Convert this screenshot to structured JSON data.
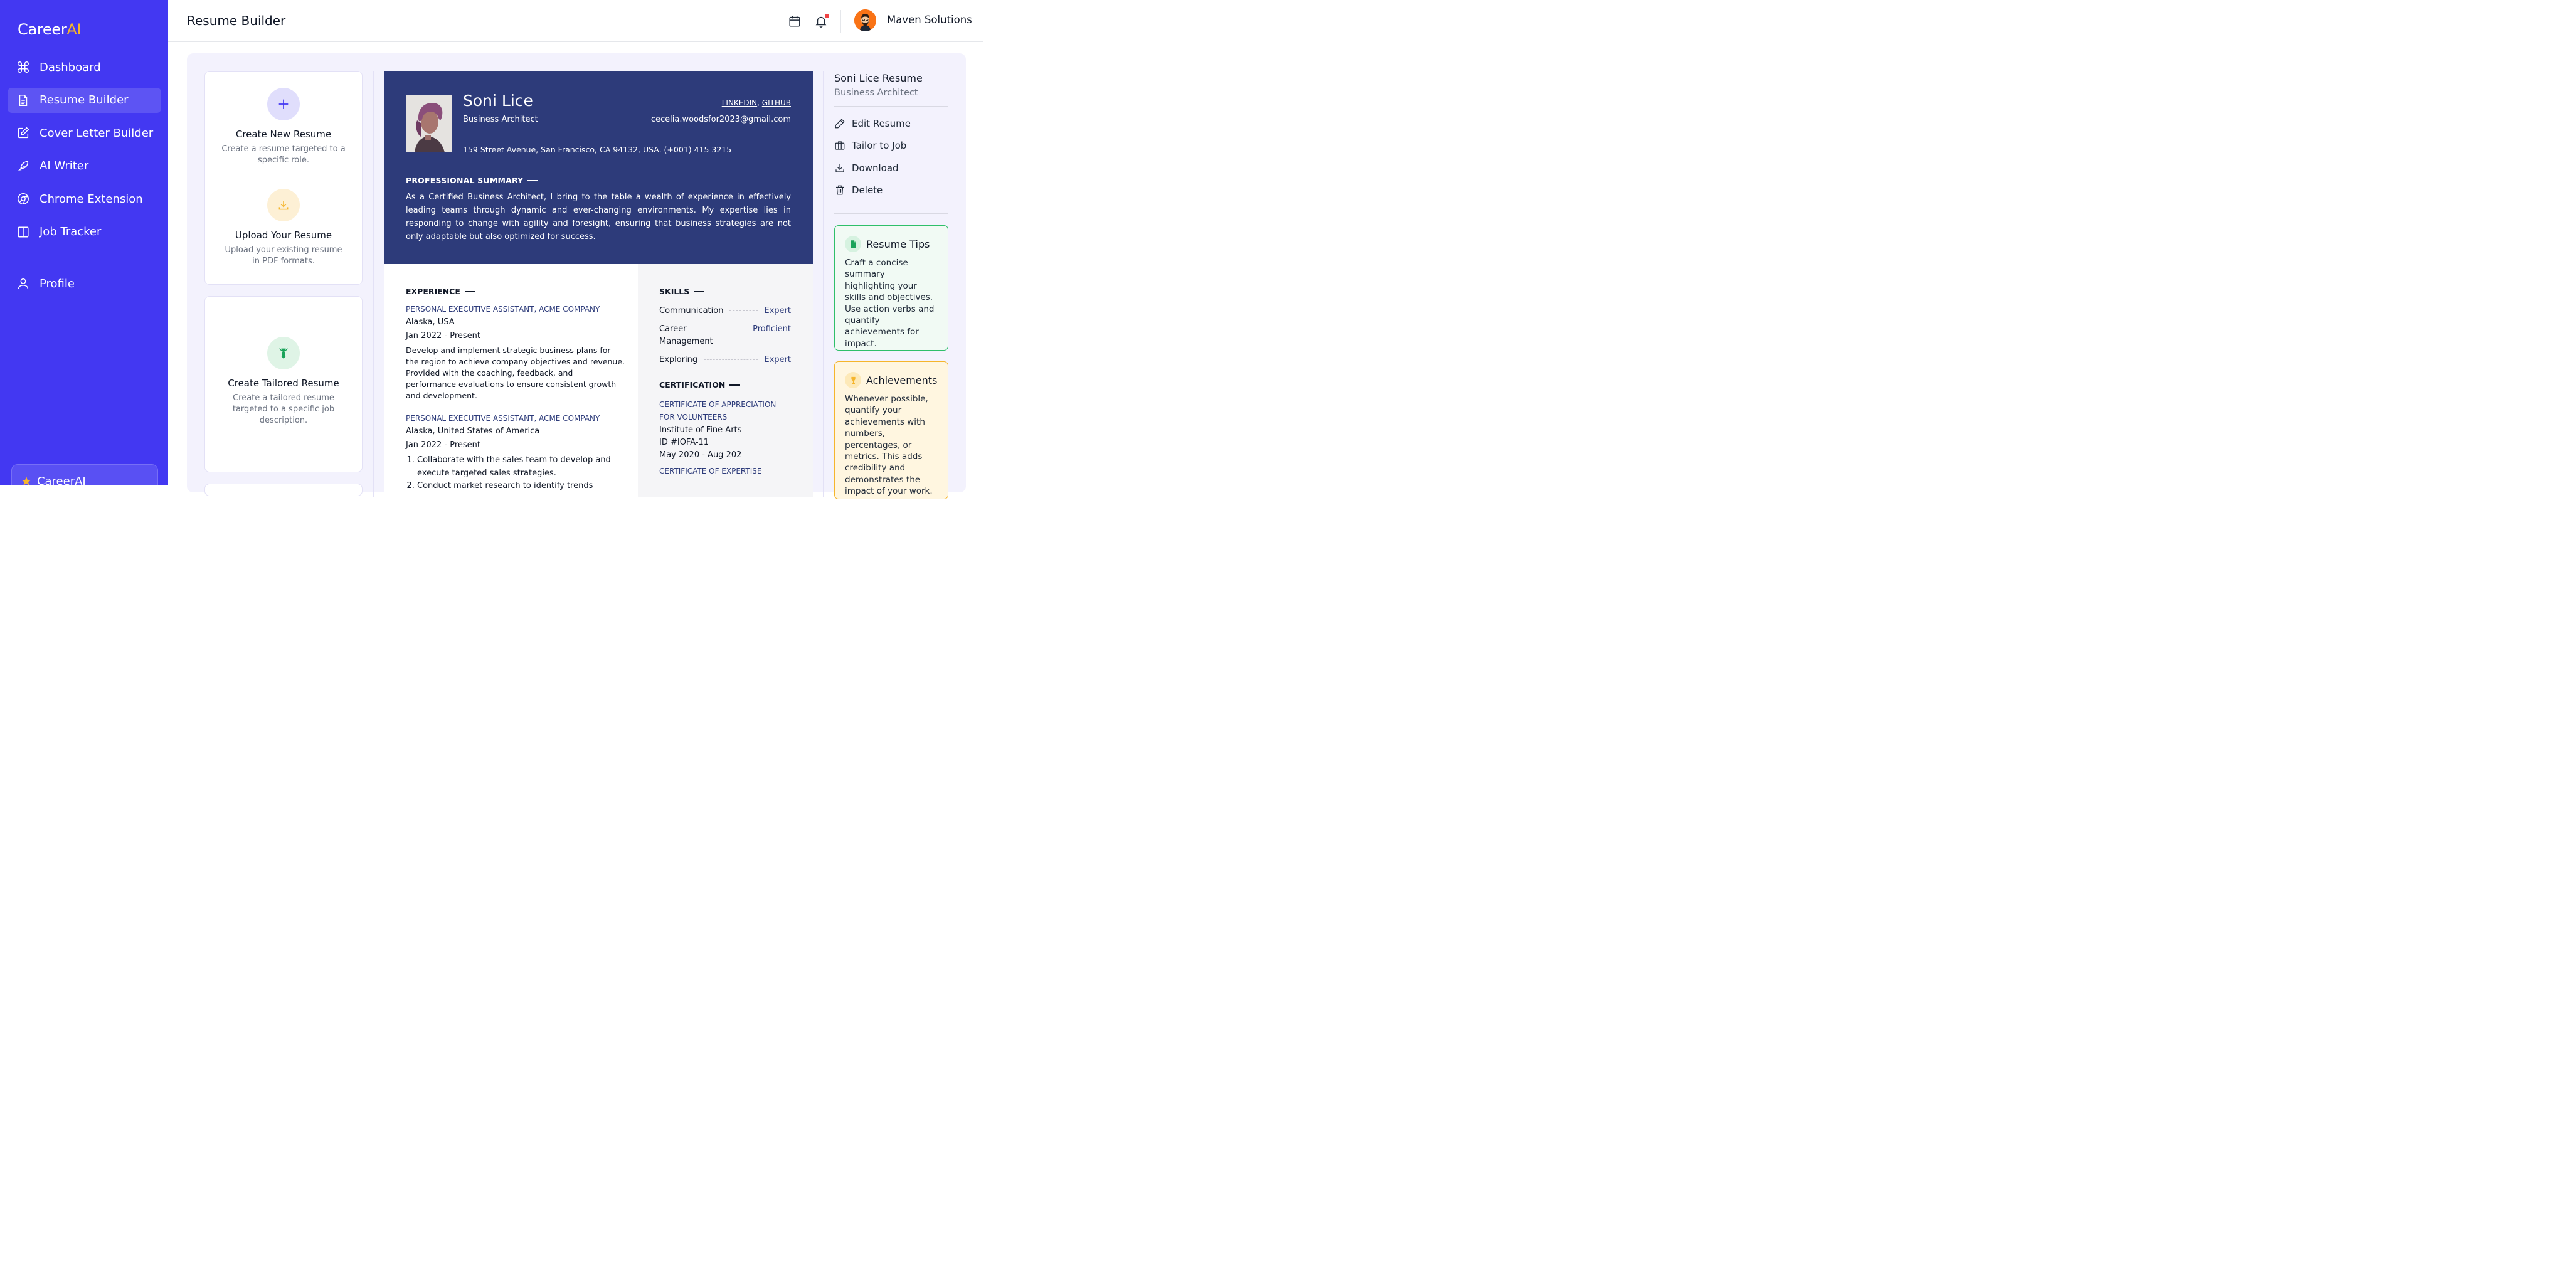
{
  "brand": {
    "name_main": "Career",
    "name_accent": "AI"
  },
  "sidebar": {
    "items": [
      {
        "label": "Dashboard",
        "icon": "command-icon"
      },
      {
        "label": "Resume Builder",
        "icon": "document-icon",
        "active": true
      },
      {
        "label": "Cover Letter Builder",
        "icon": "edit-icon"
      },
      {
        "label": "AI Writer",
        "icon": "feather-icon"
      },
      {
        "label": "Chrome Extension",
        "icon": "chrome-icon"
      },
      {
        "label": "Job Tracker",
        "icon": "columns-icon"
      }
    ],
    "profile_label": "Profile",
    "promo_label": "CareerAI"
  },
  "header": {
    "title": "Resume Builder",
    "org_name": "Maven Solutions"
  },
  "options": {
    "create_new": {
      "title": "Create New Resume",
      "desc": "Create a resume targeted to a specific role."
    },
    "upload": {
      "title": "Upload Your Resume",
      "desc": "Upload your existing resume in PDF formats."
    },
    "tailored": {
      "title": "Create Tailored Resume",
      "desc": "Create a tailored resume targeted to a specific job description."
    }
  },
  "resume": {
    "name": "Soni Lice",
    "role": "Business Architect",
    "link_linkedin": "LINKEDIN",
    "link_sep": ", ",
    "link_github": "GITHUB",
    "email": "cecelia.woodsfor2023@gmail.com",
    "address": "159 Street Avenue, San Francisco, CA 94132, USA. (+001) 415 3215",
    "summary_heading": "PROFESSIONAL SUMMARY",
    "summary": "As a Certified Business Architect, I bring to the table a wealth of experience in effectively leading teams through dynamic and ever-changing environments. My expertise lies in responding to change with agility and foresight, ensuring that business strategies are not only adaptable but also optimized for success.",
    "experience_heading": "EXPERIENCE",
    "jobs": [
      {
        "title": "PERSONAL EXECUTIVE ASSISTANT, ACME COMPANY",
        "location": "Alaska, USA",
        "dates": "Jan 2022 - Present",
        "desc": "Develop and implement strategic business plans for the region to achieve company objectives and revenue. Provided with the coaching, feedback, and performance evaluations to ensure consistent growth and development."
      },
      {
        "title": "PERSONAL EXECUTIVE ASSISTANT, ACME COMPANY",
        "location": "Alaska, United States of America",
        "dates": "Jan 2022 - Present",
        "bullets": [
          "Collaborate with the sales team to develop and execute targeted sales strategies.",
          "Conduct market research to identify trends"
        ]
      }
    ],
    "skills_heading": "SKILLS",
    "skills": [
      {
        "name": "Communication",
        "level": "Expert"
      },
      {
        "name": "Career Management",
        "level": "Proficient"
      },
      {
        "name": "Exploring",
        "level": "Expert"
      }
    ],
    "cert_heading": "CERTIFICATION",
    "certs": [
      {
        "title": "CERTIFICATE OF APPRECIATION FOR VOLUNTEERS",
        "org": "Institute of Fine Arts",
        "id": "ID #IOFA-11",
        "dates": "May 2020 - Aug 202"
      },
      {
        "title": "CERTIFICATE OF EXPERTISE"
      }
    ]
  },
  "panel": {
    "title": "Soni Lice Resume",
    "subtitle": "Business Architect",
    "actions": [
      {
        "label": "Edit Resume",
        "icon": "pencil-icon"
      },
      {
        "label": "Tailor to Job",
        "icon": "briefcase-icon"
      },
      {
        "label": "Download",
        "icon": "download-icon"
      },
      {
        "label": "Delete",
        "icon": "trash-icon"
      }
    ],
    "tips": [
      {
        "title": "Resume Tips",
        "body": "Craft a concise summary highlighting your skills and objectives. Use action verbs and quantify achievements for impact."
      },
      {
        "title": "Achievements",
        "body": "Whenever possible, quantify your achievements with numbers, percentages, or metrics. This adds credibility and demonstrates the impact of your work."
      }
    ]
  },
  "colors": {
    "sidebar": "#4338f2",
    "accent": "#f5b52c",
    "resume_header": "#2d3b7a",
    "tip_green": "#2fbf6a"
  }
}
